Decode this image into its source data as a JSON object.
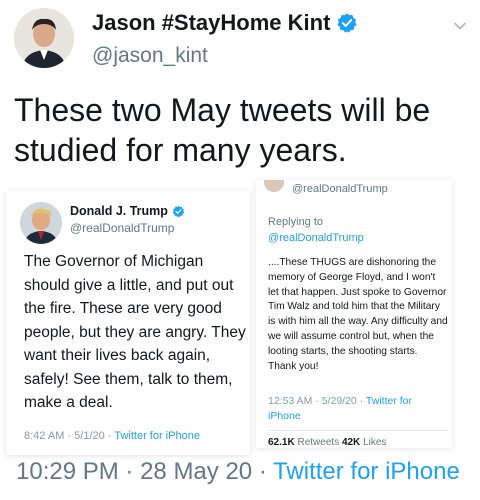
{
  "tweet": {
    "author_name": "Jason #StayHome Kint",
    "author_handle": "@jason_kint",
    "text": "These two May tweets will be studied for many years.",
    "time": "10:29 PM",
    "separator": "·",
    "date": "28 May 20",
    "source": "Twitter for iPhone"
  },
  "embed_left": {
    "author_name": "Donald J. Trump",
    "author_handle": "@realDonaldTrump",
    "text": "The Governor of Michigan should give a little, and put out the fire. These are very good people, but they are angry. They want their lives back again, safely! See them, talk to them, make a deal.",
    "time": "8:42 AM",
    "separator": "·",
    "date": "5/1/20",
    "source": "Twitter for iPhone"
  },
  "embed_right": {
    "author_handle": "@realDonaldTrump",
    "replying_label": "Replying to",
    "replying_handle": "@realDonaldTrump",
    "text": "....These THUGS are dishonoring the memory of George Floyd, and I won't let that happen. Just spoke to Governor Tim Walz and told him that the Military is with him all the way. Any difficulty and we will assume control but, when the looting starts, the shooting starts. Thank you!",
    "time": "12:53 AM",
    "separator": "·",
    "date": "5/29/20",
    "source": "Twitter for iPhone",
    "retweets_count": "62.1K",
    "retweets_label": "Retweets",
    "likes_count": "42K",
    "likes_label": "Likes"
  },
  "icons": {
    "verified": "verified-badge-icon",
    "menu": "chevron-down-icon"
  },
  "colors": {
    "twitter_blue": "#1da1f2",
    "text_primary": "#14171a",
    "text_secondary": "#657786"
  }
}
